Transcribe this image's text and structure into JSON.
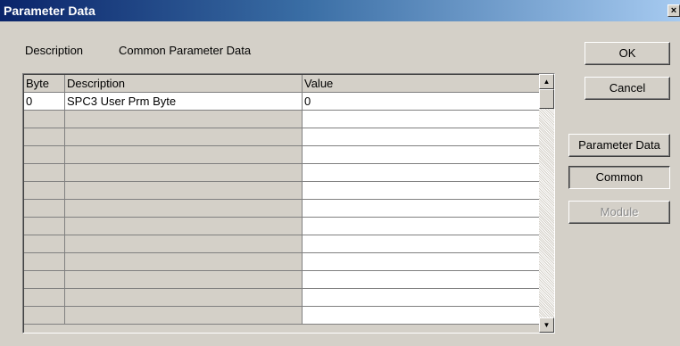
{
  "window": {
    "title": "Parameter Data",
    "close_label": "×"
  },
  "description": {
    "label": "Description",
    "value": "Common Parameter Data"
  },
  "table": {
    "headers": [
      "Byte",
      "Description",
      "Value"
    ],
    "rows": [
      {
        "byte": "0",
        "description": "SPC3 User Prm Byte",
        "value": "0"
      }
    ],
    "empty_rows": 12
  },
  "scrollbar": {
    "up_icon": "▲",
    "down_icon": "▼"
  },
  "buttons": {
    "ok": "OK",
    "cancel": "Cancel",
    "parameter_data": "Parameter Data",
    "common": "Common",
    "module": "Module"
  }
}
